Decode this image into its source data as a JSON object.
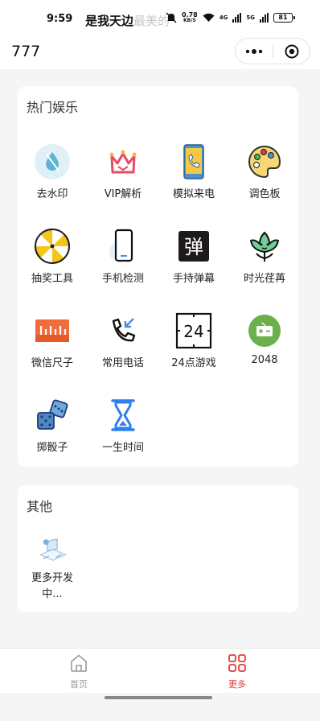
{
  "status_bar": {
    "time": "9:59",
    "ticker": "是我天边",
    "ticker_faded": "最美的",
    "net_speed_value": "0.78",
    "net_speed_unit": "KB/S",
    "signal_1": "4G",
    "signal_2": "5G",
    "battery": "81"
  },
  "nav": {
    "title": "777"
  },
  "hot_section": {
    "title": "热门娱乐",
    "items": [
      {
        "label": "去水印",
        "icon": "water-drop-icon"
      },
      {
        "label": "VIP解析",
        "icon": "crown-icon"
      },
      {
        "label": "模拟来电",
        "icon": "phone-call-icon"
      },
      {
        "label": "调色板",
        "icon": "palette-icon"
      },
      {
        "label": "抽奖工具",
        "icon": "lottery-wheel-icon"
      },
      {
        "label": "手机检测",
        "icon": "phone-check-icon"
      },
      {
        "label": "手持弹幕",
        "icon": "danmu-icon",
        "glyph": "弹"
      },
      {
        "label": "时光荏苒",
        "icon": "flower-icon"
      },
      {
        "label": "微信尺子",
        "icon": "ruler-icon"
      },
      {
        "label": "常用电话",
        "icon": "phone-incoming-icon"
      },
      {
        "label": "24点游戏",
        "icon": "24-game-icon",
        "glyph": "24"
      },
      {
        "label": "2048",
        "icon": "game-2048-icon"
      },
      {
        "label": "掷骰子",
        "icon": "dice-icon"
      },
      {
        "label": "一生时间",
        "icon": "hourglass-icon"
      }
    ]
  },
  "other_section": {
    "title": "其他",
    "items": [
      {
        "label_line1": "更多开发",
        "label_line2": "中...",
        "icon": "developing-icon"
      }
    ]
  },
  "tabbar": {
    "home_label": "首页",
    "more_label": "更多",
    "active_color": "#e53935",
    "inactive_color": "#999999"
  }
}
